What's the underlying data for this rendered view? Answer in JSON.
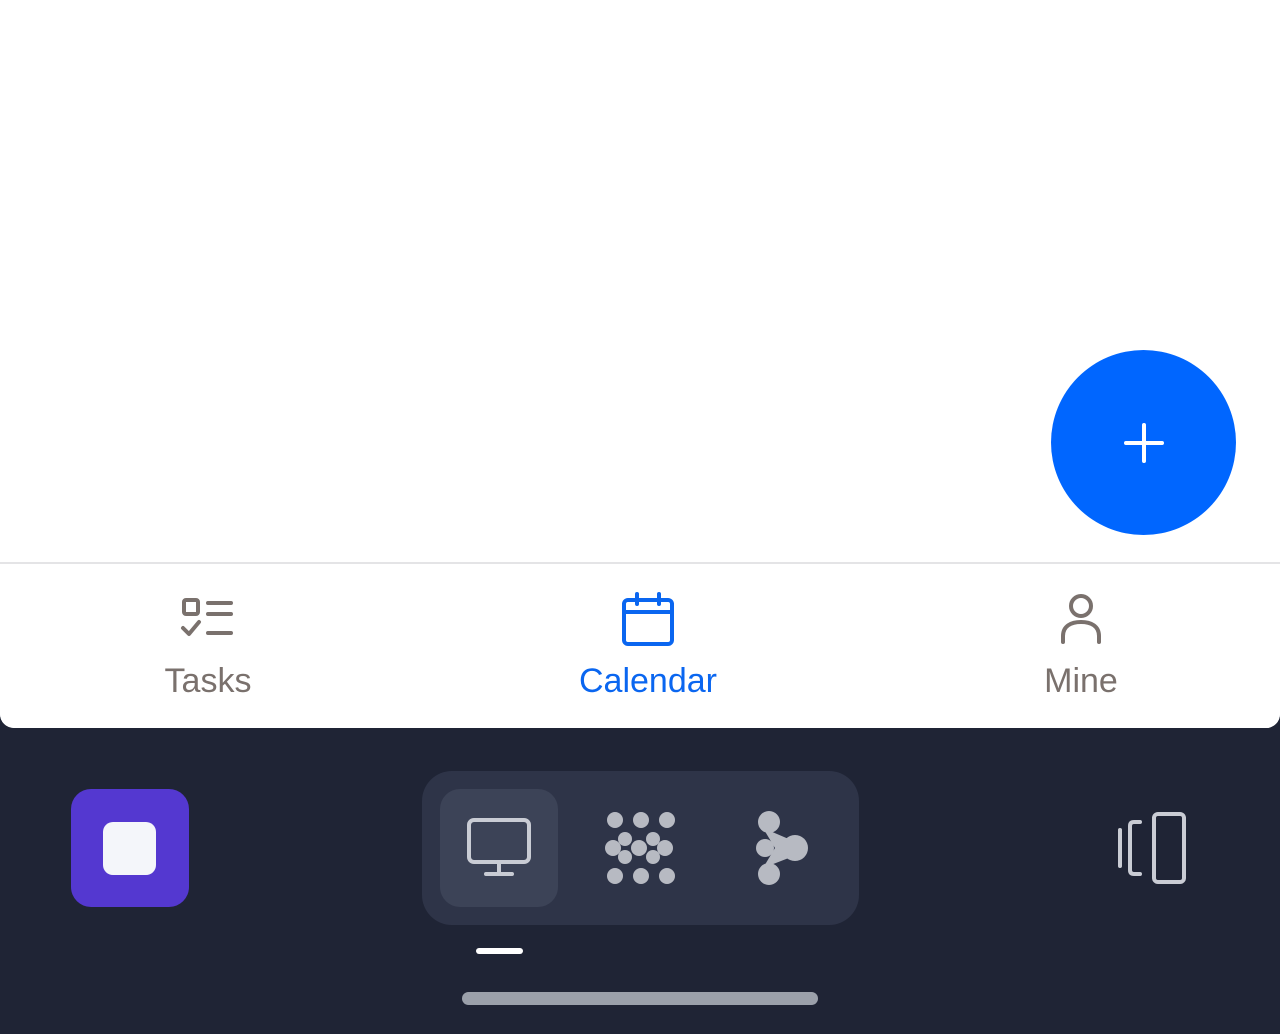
{
  "app": {
    "fab": {
      "icon": "plus-icon",
      "color": "#0066ff"
    },
    "tabs": [
      {
        "label": "Tasks",
        "icon": "tasks-checklist-icon",
        "active": false
      },
      {
        "label": "Calendar",
        "icon": "calendar-icon",
        "active": true
      },
      {
        "label": "Mine",
        "icon": "person-icon",
        "active": false
      }
    ],
    "accent_color": "#0a66f0",
    "inactive_color": "#7a716d"
  },
  "system_bar": {
    "launcher_icon": "stop-square-icon",
    "launcher_color": "#5438d0",
    "dock_items": [
      {
        "icon": "desktop-monitor-icon",
        "active": true
      },
      {
        "icon": "dots-grid-icon",
        "active": false
      },
      {
        "icon": "share-nodes-icon",
        "active": false
      }
    ],
    "rotate_icon": "rotate-device-icon",
    "background": "#1f2435"
  }
}
